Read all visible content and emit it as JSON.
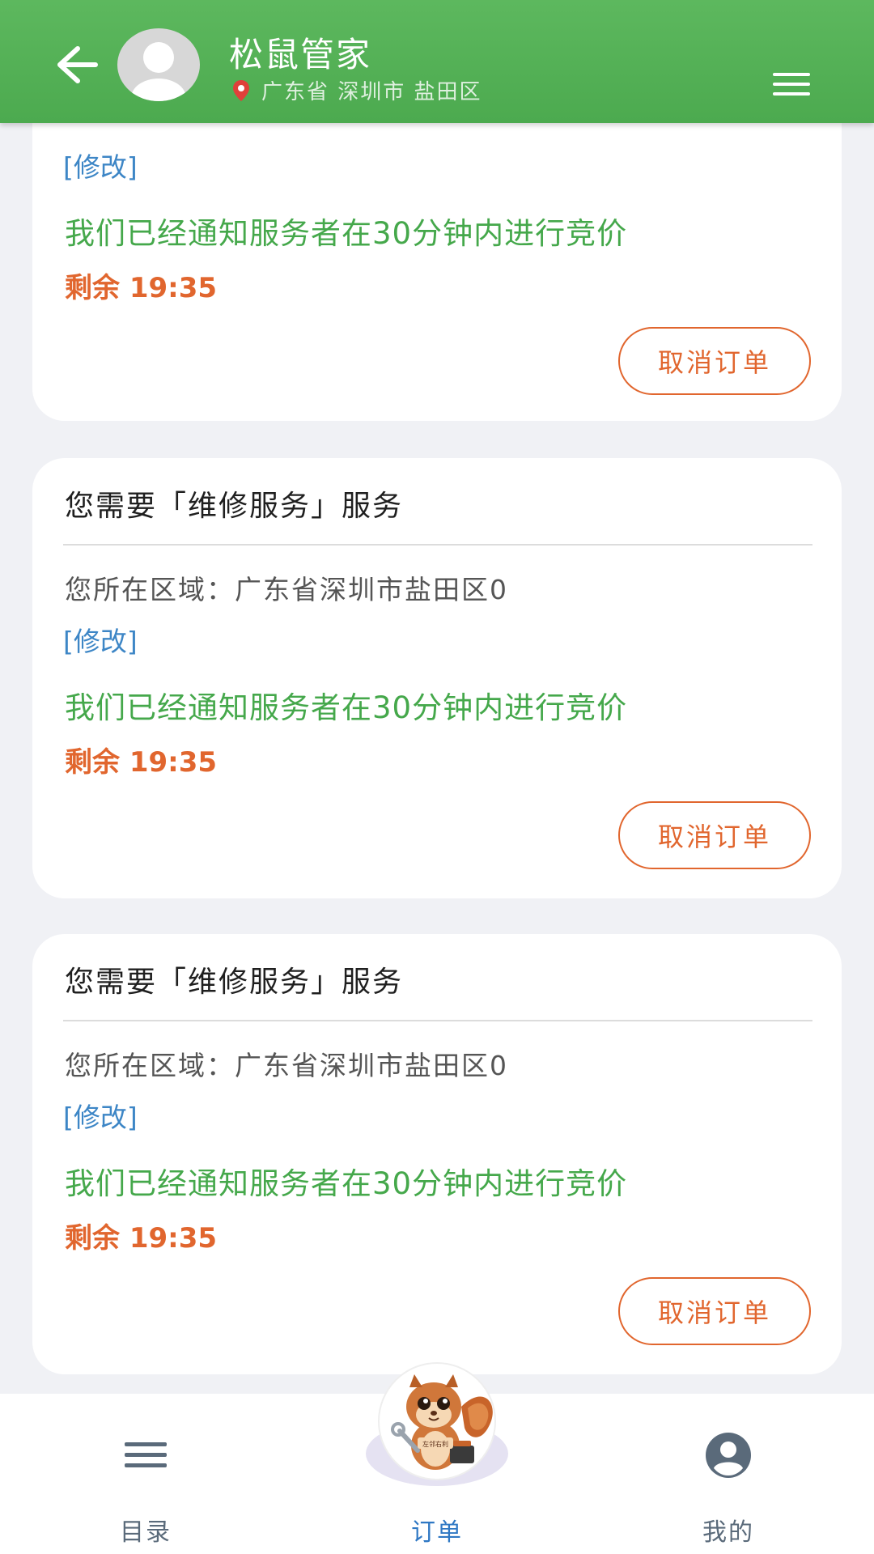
{
  "header": {
    "title": "松鼠管家",
    "location": "广东省 深圳市 盐田区"
  },
  "cards": [
    {
      "edit": "[修改]",
      "notice": "我们已经通知服务者在30分钟内进行竞价",
      "remaining": "剩余 19:35",
      "cancel": "取消订单"
    },
    {
      "title": "您需要「维修服务」服务",
      "area": "您所在区域：广东省深圳市盐田区0",
      "edit": "[修改]",
      "notice": "我们已经通知服务者在30分钟内进行竞价",
      "remaining": "剩余 19:35",
      "cancel": "取消订单"
    },
    {
      "title": "您需要「维修服务」服务",
      "area": "您所在区域：广东省深圳市盐田区0",
      "edit": "[修改]",
      "notice": "我们已经通知服务者在30分钟内进行竞价",
      "remaining": "剩余 19:35",
      "cancel": "取消订单"
    }
  ],
  "mascot": {
    "badge": "左邻右利"
  },
  "nav": {
    "items": [
      {
        "label": "目录",
        "icon": "menu-icon",
        "active": false
      },
      {
        "label": "订单",
        "icon": "mascot-icon",
        "active": true
      },
      {
        "label": "我的",
        "icon": "user-icon",
        "active": false
      }
    ]
  },
  "colors": {
    "header": "#4caa4f",
    "notice": "#45a84b",
    "remaining": "#e1662e",
    "edit": "#3d86c6",
    "nav_active": "#2f78c4"
  }
}
